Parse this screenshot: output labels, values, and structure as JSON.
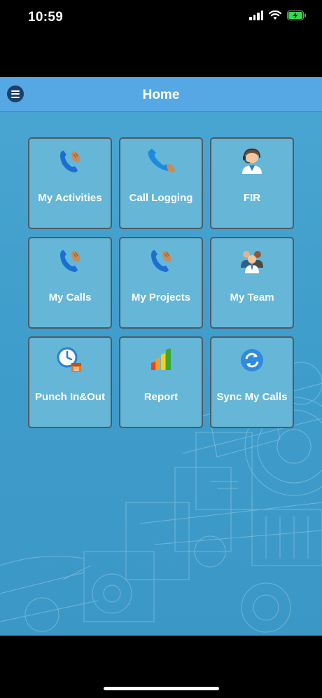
{
  "status_bar": {
    "time": "10:59",
    "icons": [
      "signal-icon",
      "wifi-icon",
      "battery-charging-icon"
    ]
  },
  "header": {
    "title": "Home",
    "menu_icon": "hamburger-menu-icon"
  },
  "tiles": [
    {
      "label": "My Activities",
      "icon": "phone-hand-icon"
    },
    {
      "label": "Call Logging",
      "icon": "phone-handset-icon"
    },
    {
      "label": "FIR",
      "icon": "headset-agent-icon"
    },
    {
      "label": "My Calls",
      "icon": "phone-hand-icon"
    },
    {
      "label": "My Projects",
      "icon": "phone-hand-icon"
    },
    {
      "label": "My Team",
      "icon": "team-people-icon"
    },
    {
      "label": "Punch In&Out",
      "icon": "clock-calendar-icon"
    },
    {
      "label": "Report",
      "icon": "bar-chart-icon"
    },
    {
      "label": "Sync My Calls",
      "icon": "sync-icon"
    }
  ],
  "colors": {
    "background": "#3f9dcb",
    "header": "#55a8e4",
    "tile": "#66b6d7",
    "tile_border": "#4f5a63",
    "menu_button": "#1e3f66"
  }
}
